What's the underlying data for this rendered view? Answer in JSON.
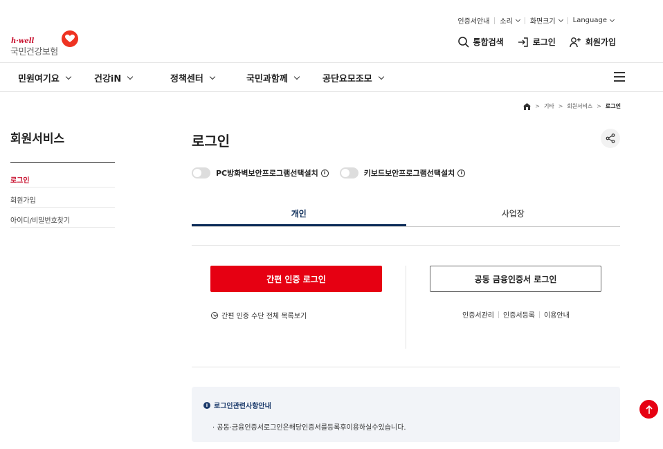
{
  "util": {
    "items": [
      "인증서안내",
      "소리",
      "화면크기",
      "Language"
    ]
  },
  "logo": {
    "brand": "h·well",
    "name": "국민건강보험"
  },
  "actions": {
    "search": "통합검색",
    "login": "로그인",
    "join": "회원가입"
  },
  "gnb": {
    "items": [
      "민원여기요",
      "건강iN",
      "정책센터",
      "국민과함께",
      "공단요모조모"
    ]
  },
  "breadcrumb": {
    "items": [
      "기타",
      "회원서비스",
      "로그인"
    ]
  },
  "lnb": {
    "title": "회원서비스",
    "items": [
      "로그인",
      "회원가입",
      "아이디/비밀번호찾기"
    ]
  },
  "main": {
    "title": "로그인",
    "toggles": [
      "PC방화벽보안프로그램선택설치",
      "키보드보안프로그램선택설치"
    ],
    "tabs": [
      "개인",
      "사업장"
    ],
    "simple_login_label": "간편 인증 로그인",
    "cert_login_label": "공동 금융인증서 로그인",
    "simple_list_label": "간편 인증 수단 전체 목록보기",
    "cert_links": [
      "인증서관리",
      "인증서등록",
      "이용안내"
    ]
  },
  "notice": {
    "title": "로그인관련사항안내",
    "desc": "· 공동·금융인증서로그인은해당인증서를등록후이용하실수있습니다."
  },
  "colors": {
    "accent_red": "#e60012",
    "navy": "#0e2e5a"
  }
}
